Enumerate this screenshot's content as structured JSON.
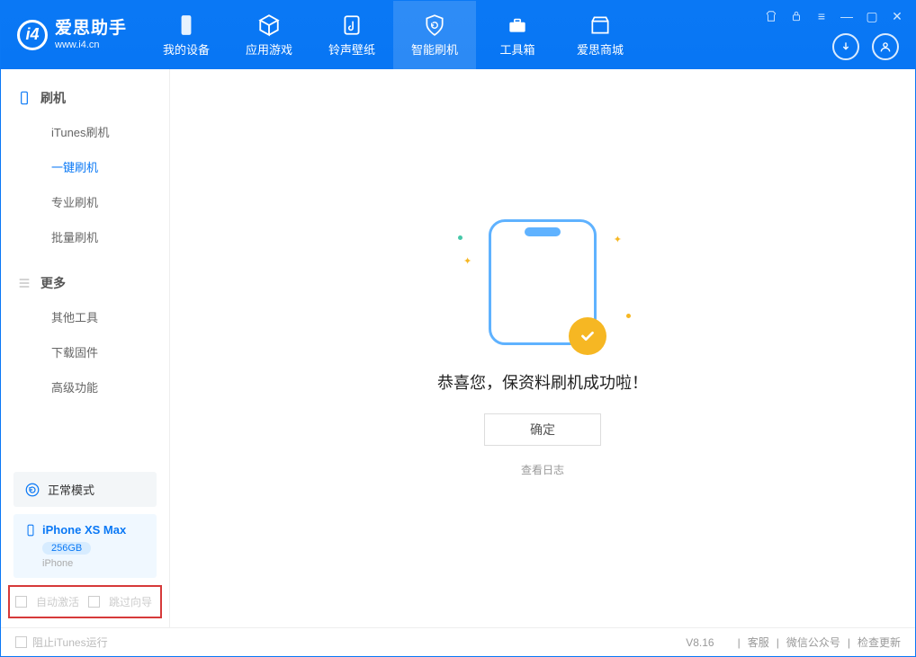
{
  "app": {
    "title": "爱思助手",
    "subtitle": "www.i4.cn"
  },
  "tabs": [
    {
      "label": "我的设备"
    },
    {
      "label": "应用游戏"
    },
    {
      "label": "铃声壁纸"
    },
    {
      "label": "智能刷机"
    },
    {
      "label": "工具箱"
    },
    {
      "label": "爱思商城"
    }
  ],
  "sidebar": {
    "section1": "刷机",
    "items1": [
      "iTunes刷机",
      "一键刷机",
      "专业刷机",
      "批量刷机"
    ],
    "section2": "更多",
    "items2": [
      "其他工具",
      "下载固件",
      "高级功能"
    ]
  },
  "mode": {
    "label": "正常模式"
  },
  "device": {
    "name": "iPhone XS Max",
    "storage": "256GB",
    "type": "iPhone"
  },
  "options": {
    "auto_activate": "自动激活",
    "skip_wizard": "跳过向导"
  },
  "main": {
    "success_text": "恭喜您，保资料刷机成功啦！",
    "ok": "确定",
    "view_log": "查看日志"
  },
  "footer": {
    "block_itunes": "阻止iTunes运行",
    "version": "V8.16",
    "links": [
      "客服",
      "微信公众号",
      "检查更新"
    ]
  }
}
